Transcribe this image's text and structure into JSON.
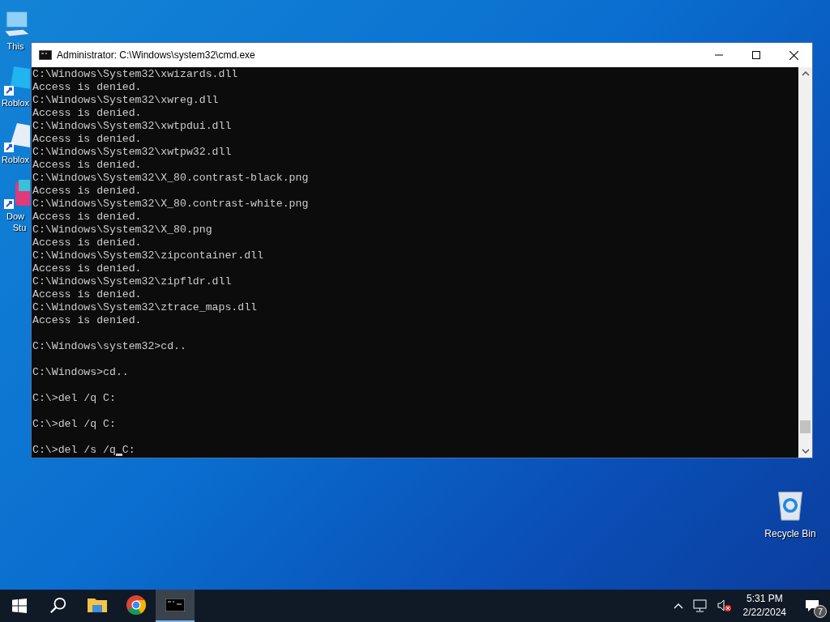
{
  "desktop_icons": [
    {
      "label": "This",
      "kind": "computer"
    },
    {
      "label": "Roblox",
      "kind": "roblox-blue"
    },
    {
      "label": "Roblox",
      "kind": "roblox-white"
    },
    {
      "label": "Dow",
      "label_2": "Stu",
      "kind": "studio"
    }
  ],
  "recycle_bin": {
    "label": "Recycle Bin"
  },
  "window": {
    "title": "Administrator: C:\\Windows\\system32\\cmd.exe",
    "console_blocks": [
      [
        "C:\\Windows\\System32\\xwizards.dll",
        "Access is denied.",
        "C:\\Windows\\System32\\xwreg.dll",
        "Access is denied.",
        "C:\\Windows\\System32\\xwtpdui.dll",
        "Access is denied.",
        "C:\\Windows\\System32\\xwtpw32.dll",
        "Access is denied.",
        "C:\\Windows\\System32\\X_80.contrast-black.png",
        "Access is denied.",
        "C:\\Windows\\System32\\X_80.contrast-white.png",
        "Access is denied.",
        "C:\\Windows\\System32\\X_80.png",
        "Access is denied.",
        "C:\\Windows\\System32\\zipcontainer.dll",
        "Access is denied.",
        "C:\\Windows\\System32\\zipfldr.dll",
        "Access is denied.",
        "C:\\Windows\\System32\\ztrace_maps.dll",
        "Access is denied."
      ],
      [
        "C:\\Windows\\system32>cd.."
      ],
      [
        "C:\\Windows>cd.."
      ],
      [
        "C:\\>del /q C:"
      ],
      [
        "C:\\>del /q C:"
      ]
    ],
    "input_line": {
      "before_cursor": "C:\\>del /s /q",
      "after_cursor": "C:"
    }
  },
  "taskbar": {
    "apps": [
      {
        "kind": "explorer",
        "selected": false
      },
      {
        "kind": "chrome",
        "selected": false
      },
      {
        "kind": "cmd",
        "selected": true
      }
    ],
    "time": "5:31 PM",
    "date": "2/22/2024",
    "notification_count": "7"
  }
}
